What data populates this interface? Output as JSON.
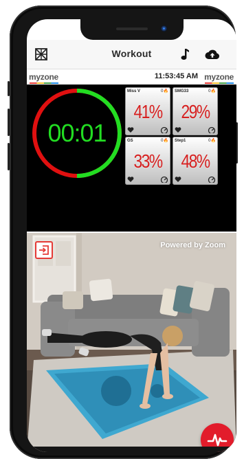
{
  "header": {
    "title": "Workout",
    "left_icon": "grid-scan-icon",
    "right_icons": [
      "music-note-icon",
      "cloud-upload-icon"
    ]
  },
  "dashboard": {
    "logo_left": {
      "my": "my",
      "zone": "zone"
    },
    "logo_right": {
      "my": "my",
      "zone": "zone"
    },
    "time": "11:53:45 AM",
    "timer": "00:01",
    "timer_progress_fraction": 0.5,
    "tiles": [
      {
        "name": "Miss V",
        "flame_count": "0",
        "percent": "41%"
      },
      {
        "name": "SMG33",
        "flame_count": "0",
        "percent": "29%"
      },
      {
        "name": "GS",
        "flame_count": "0",
        "percent": "33%"
      },
      {
        "name": "Step1",
        "flame_count": "0",
        "percent": "48%"
      }
    ],
    "colors": {
      "ring_green": "#22dd22",
      "ring_red": "#e01010",
      "percent_red": "#d62020"
    }
  },
  "video": {
    "powered_by": "Powered by Zoom",
    "exit_icon": "exit-session-icon",
    "heart_rate_button_icon": "heartbeat-icon"
  }
}
